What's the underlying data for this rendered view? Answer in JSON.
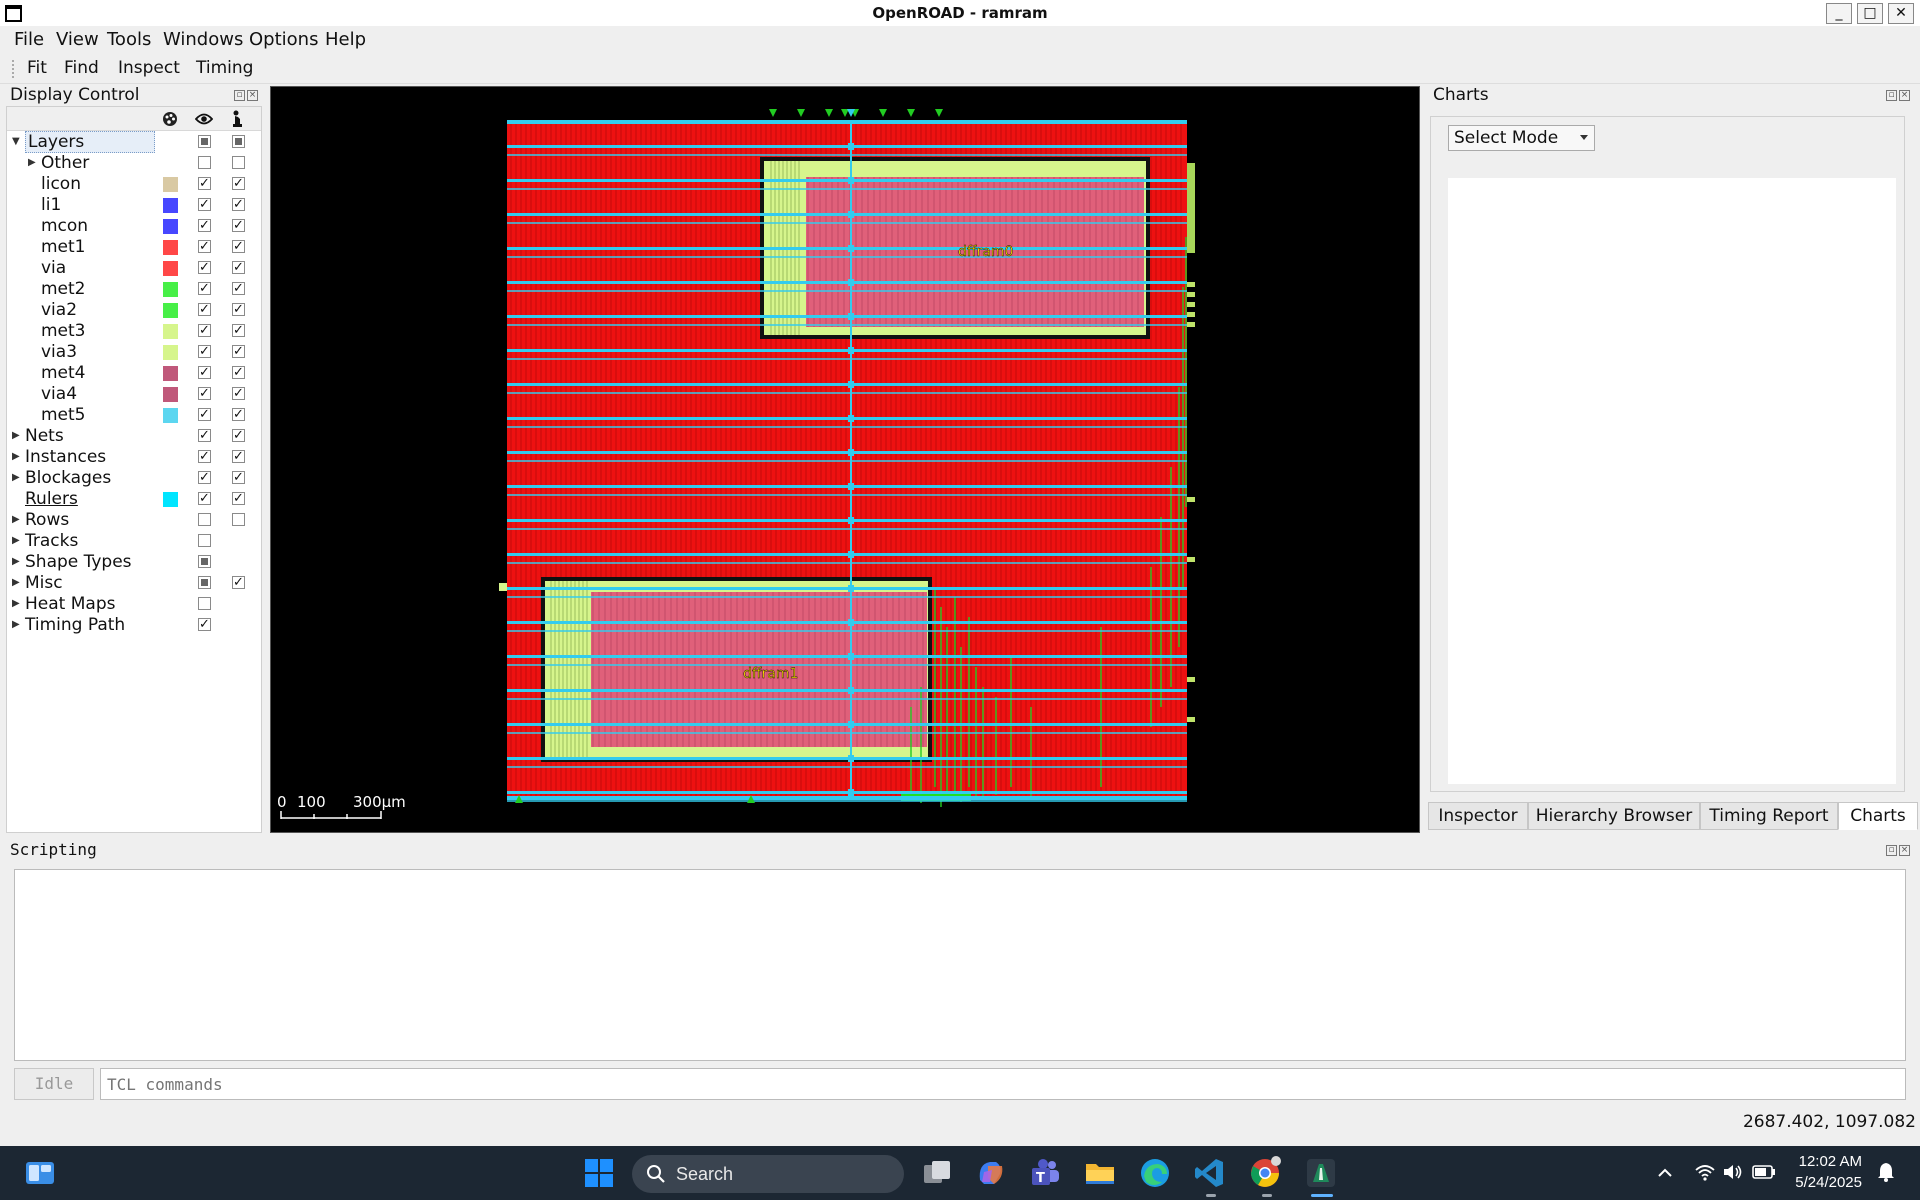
{
  "window": {
    "title": "OpenROAD - ramram",
    "controls": [
      "_",
      "□",
      "✕"
    ]
  },
  "menubar": {
    "items": [
      {
        "label": "File"
      },
      {
        "label": "View"
      },
      {
        "label": "Tools"
      },
      {
        "label": "Windows"
      },
      {
        "label": "Options"
      },
      {
        "label": "Help"
      }
    ]
  },
  "toolbar": {
    "items": [
      {
        "label": "Fit"
      },
      {
        "label": "Find"
      },
      {
        "label": "Inspect"
      },
      {
        "label": "Timing"
      }
    ]
  },
  "display_control": {
    "title": "Display Control",
    "columns": [
      "palette-icon",
      "eye-icon",
      "pointer-icon"
    ],
    "rows": [
      {
        "label": "Layers",
        "color": "",
        "visible": "partial",
        "selectable": "partial",
        "expander": "open",
        "selected": true
      },
      {
        "label": "Other",
        "color": "",
        "visible": "off",
        "selectable": "off",
        "expander": "closed"
      },
      {
        "label": "licon",
        "color": "#d9c9a3",
        "visible": "on",
        "selectable": "on"
      },
      {
        "label": "li1",
        "color": "#4747ff",
        "visible": "on",
        "selectable": "on"
      },
      {
        "label": "mcon",
        "color": "#4747ff",
        "visible": "on",
        "selectable": "on"
      },
      {
        "label": "met1",
        "color": "#ff4747",
        "visible": "on",
        "selectable": "on"
      },
      {
        "label": "via",
        "color": "#ff4747",
        "visible": "on",
        "selectable": "on"
      },
      {
        "label": "met2",
        "color": "#47ef47",
        "visible": "on",
        "selectable": "on"
      },
      {
        "label": "via2",
        "color": "#47ef47",
        "visible": "on",
        "selectable": "on"
      },
      {
        "label": "met3",
        "color": "#d6f58c",
        "visible": "on",
        "selectable": "on"
      },
      {
        "label": "via3",
        "color": "#d6f58c",
        "visible": "on",
        "selectable": "on"
      },
      {
        "label": "met4",
        "color": "#c0587a",
        "visible": "on",
        "selectable": "on"
      },
      {
        "label": "via4",
        "color": "#c0587a",
        "visible": "on",
        "selectable": "on"
      },
      {
        "label": "met5",
        "color": "#5cd6f0",
        "visible": "on",
        "selectable": "on"
      },
      {
        "label": "Nets",
        "color": "",
        "visible": "on",
        "selectable": "on",
        "expander": "closed"
      },
      {
        "label": "Instances",
        "color": "",
        "visible": "on",
        "selectable": "on",
        "expander": "closed"
      },
      {
        "label": "Blockages",
        "color": "",
        "visible": "on",
        "selectable": "on",
        "expander": "closed"
      },
      {
        "label": "Rulers",
        "color": "#00e5ff",
        "visible": "on",
        "selectable": "on",
        "underline": true
      },
      {
        "label": "Rows",
        "color": "",
        "visible": "off",
        "selectable": "off",
        "expander": "closed"
      },
      {
        "label": "Tracks",
        "color": "",
        "visible": "off",
        "selectable": "",
        "expander": "closed"
      },
      {
        "label": "Shape Types",
        "color": "",
        "visible": "partial",
        "selectable": "",
        "expander": "closed"
      },
      {
        "label": "Misc",
        "color": "",
        "visible": "partial",
        "selectable": "on",
        "expander": "closed"
      },
      {
        "label": "Heat Maps",
        "color": "",
        "visible": "off",
        "selectable": "",
        "expander": "closed"
      },
      {
        "label": "Timing Path",
        "color": "",
        "visible": "on",
        "selectable": "",
        "expander": "closed"
      }
    ]
  },
  "layout": {
    "instances": [
      {
        "name": "dffram0"
      },
      {
        "name": "dffram1"
      }
    ],
    "scale_bar": {
      "ticks": [
        "0",
        "100",
        "300µm"
      ]
    },
    "colors": {
      "met1": "#ff1a1a",
      "met3": "#d6f58c",
      "met4": "#e0607a",
      "met5": "#33ccee",
      "met2": "#22dd22"
    }
  },
  "charts": {
    "title": "Charts",
    "mode_select": {
      "value": "Select Mode"
    }
  },
  "right_tabs": [
    {
      "label": "Inspector",
      "active": false
    },
    {
      "label": "Hierarchy Browser",
      "active": false
    },
    {
      "label": "Timing Report",
      "active": false
    },
    {
      "label": "Charts",
      "active": true
    }
  ],
  "scripting": {
    "title": "Scripting",
    "status_button": "Idle",
    "input_placeholder": "TCL commands"
  },
  "statusbar": {
    "coordinates": "2687.402, 1097.082"
  },
  "taskbar": {
    "search_label": "Search",
    "time": "12:02 AM",
    "date": "5/24/2025",
    "icons": [
      "widgets-icon",
      "start-icon",
      "search-icon",
      "task-view-icon",
      "copilot-icon",
      "teams-icon",
      "file-explorer-icon",
      "edge-icon",
      "vscode-icon",
      "chrome-icon",
      "openroad-icon"
    ],
    "tray_icons": [
      "chevron-up-icon",
      "wifi-icon",
      "volume-icon",
      "battery-icon",
      "notification-icon"
    ]
  }
}
